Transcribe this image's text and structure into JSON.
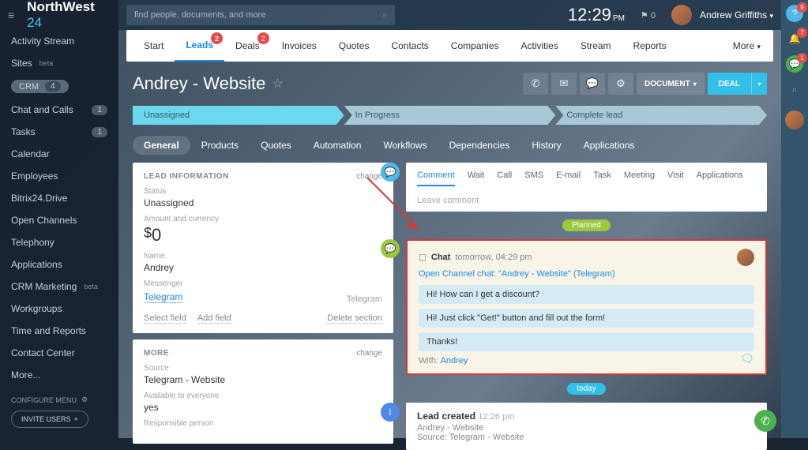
{
  "brand": {
    "left": "NorthWest",
    "right": "24"
  },
  "search": {
    "placeholder": "find people, documents, and more"
  },
  "clock": {
    "time": "12:29",
    "ampm": "PM"
  },
  "flag": {
    "count": "0"
  },
  "user": {
    "name": "Andrew Griffiths"
  },
  "sidebar": {
    "items": [
      {
        "label": "Activity Stream"
      },
      {
        "label": "Sites",
        "beta": "beta"
      },
      {
        "label": "CRM",
        "count": "4",
        "pill": true
      },
      {
        "label": "Chat and Calls",
        "count": "1"
      },
      {
        "label": "Tasks",
        "count": "1"
      },
      {
        "label": "Calendar"
      },
      {
        "label": "Employees"
      },
      {
        "label": "Bitrix24.Drive"
      },
      {
        "label": "Open Channels"
      },
      {
        "label": "Telephony"
      },
      {
        "label": "Applications"
      },
      {
        "label": "CRM Marketing",
        "beta": "beta"
      },
      {
        "label": "Workgroups"
      },
      {
        "label": "Time and Reports"
      },
      {
        "label": "Contact Center"
      },
      {
        "label": "More..."
      }
    ],
    "configure": "CONFIGURE MENU",
    "invite": "INVITE USERS"
  },
  "nav": {
    "tabs": [
      "Start",
      "Leads",
      "Deals",
      "Invoices",
      "Quotes",
      "Contacts",
      "Companies",
      "Activities",
      "Stream",
      "Reports"
    ],
    "badges": {
      "Leads": "2",
      "Deals": "2"
    },
    "active": "Leads",
    "more": "More"
  },
  "page": {
    "title": "Andrey - Website"
  },
  "buttons": {
    "document": "DOCUMENT",
    "deal": "DEAL"
  },
  "stages": [
    "Unassigned",
    "In Progress",
    "Complete lead"
  ],
  "subtabs": [
    "General",
    "Products",
    "Quotes",
    "Automation",
    "Workflows",
    "Dependencies",
    "History",
    "Applications"
  ],
  "leadInfo": {
    "title": "LEAD INFORMATION",
    "change": "change",
    "statusLabel": "Status",
    "statusVal": "Unassigned",
    "amountLabel": "Amount and currency",
    "amountVal": "0",
    "nameLabel": "Name",
    "nameVal": "Andrey",
    "msgLabel": "Messenger",
    "msgVal": "Telegram",
    "msgSide": "Telegram",
    "select": "Select field",
    "add": "Add field",
    "delete": "Delete section"
  },
  "more": {
    "title": "MORE",
    "change": "change",
    "srcLabel": "Source",
    "srcVal": "Telegram - Website",
    "availLabel": "Available to everyone",
    "availVal": "yes",
    "respLabel": "Responsible person"
  },
  "actions": {
    "tabs": [
      "Comment",
      "Wait",
      "Call",
      "SMS",
      "E-mail",
      "Task",
      "Meeting",
      "Visit",
      "Applications"
    ],
    "placeholder": "Leave comment"
  },
  "planned": "Planned",
  "chat": {
    "label": "Chat",
    "when": "tomorrow, 04:29 pm",
    "link": "Open Channel chat: \"Andrey - Website\" (Telegram)",
    "msgs": [
      "Hi! How can I get a discount?",
      "Hi! Just click \"Get!\" button and fill out the form!",
      "Thanks!"
    ],
    "withLabel": "With:",
    "withName": "Andrey"
  },
  "today": "today",
  "created": {
    "title": "Lead created",
    "time": "12:26 pm",
    "line1": "Andrey - Website",
    "line2": "Source: Telegram - Website"
  },
  "rail": {
    "help": "9",
    "bell": "7",
    "msg": "1"
  }
}
